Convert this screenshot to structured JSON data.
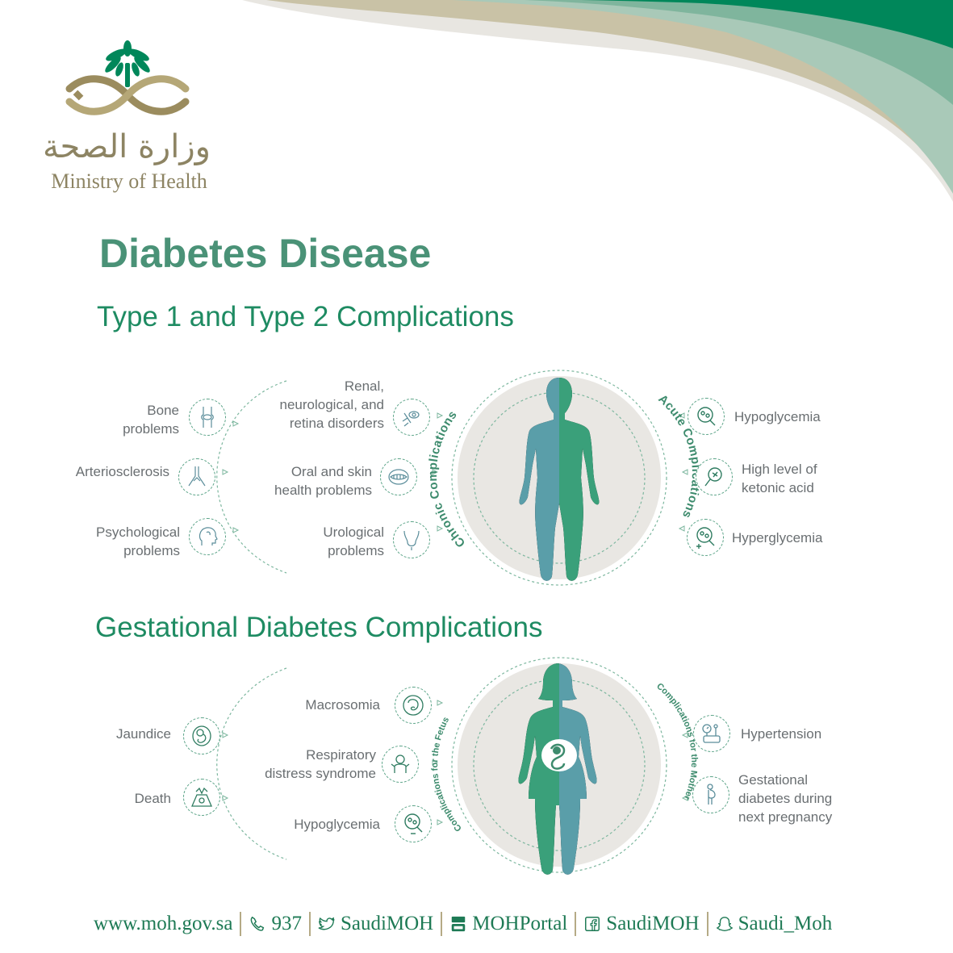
{
  "ministry": {
    "name_ar": "وزارة الصحة",
    "name_en": "Ministry of Health"
  },
  "title": "Diabetes Disease",
  "section1": {
    "heading": "Type 1 and Type 2 Complications",
    "chronic_label": "Chronic Complications",
    "acute_label": "Acute Complications",
    "outer": [
      {
        "label": "Bone\nproblems",
        "icon": "bone-joint-icon"
      },
      {
        "label": "Arteriosclerosis",
        "icon": "artery-icon"
      },
      {
        "label": "Psychological\nproblems",
        "icon": "head-icon"
      }
    ],
    "chronic": [
      {
        "label": "Renal,\nneurological, and\nretina disorders",
        "icon": "neuron-icon"
      },
      {
        "label": "Oral and skin\nhealth problems",
        "icon": "mouth-icon"
      },
      {
        "label": "Urological\nproblems",
        "icon": "bladder-icon"
      }
    ],
    "acute": [
      {
        "label": "Hypoglycemia",
        "icon": "glucose-low-icon"
      },
      {
        "label": "High level of\nketonic acid",
        "icon": "magnifier-icon"
      },
      {
        "label": "Hyperglycemia",
        "icon": "glucose-high-icon"
      }
    ]
  },
  "section2": {
    "heading": "Gestational Diabetes Complications",
    "fetus_label": "Complications for the Fetus",
    "mother_label": "Complications for the Mother",
    "outer": [
      {
        "label": "Jaundice",
        "icon": "fetus-icon"
      },
      {
        "label": "Death",
        "icon": "ultrasound-icon"
      }
    ],
    "fetus": [
      {
        "label": "Macrosomia",
        "icon": "baby-head-icon"
      },
      {
        "label": "Respiratory\ndistress syndrome",
        "icon": "infant-icon"
      },
      {
        "label": "Hypoglycemia",
        "icon": "glucose-low-icon"
      }
    ],
    "mother": [
      {
        "label": "Hypertension",
        "icon": "blood-pressure-icon"
      },
      {
        "label": "Gestational\ndiabetes during\nnext pregnancy",
        "icon": "pregnant-icon"
      }
    ]
  },
  "footer": {
    "website": "www.moh.gov.sa",
    "phone": "937",
    "twitter": "SaudiMOH",
    "youtube": "MOHPortal",
    "facebook": "SaudiMOH",
    "snapchat": "Saudi_Moh"
  },
  "colors": {
    "green_dark": "#00875a",
    "green_mid": "#4a9277",
    "teal": "#5a9ea9",
    "beige": "#b5aa86",
    "grey_disc": "#e9e7e3"
  }
}
